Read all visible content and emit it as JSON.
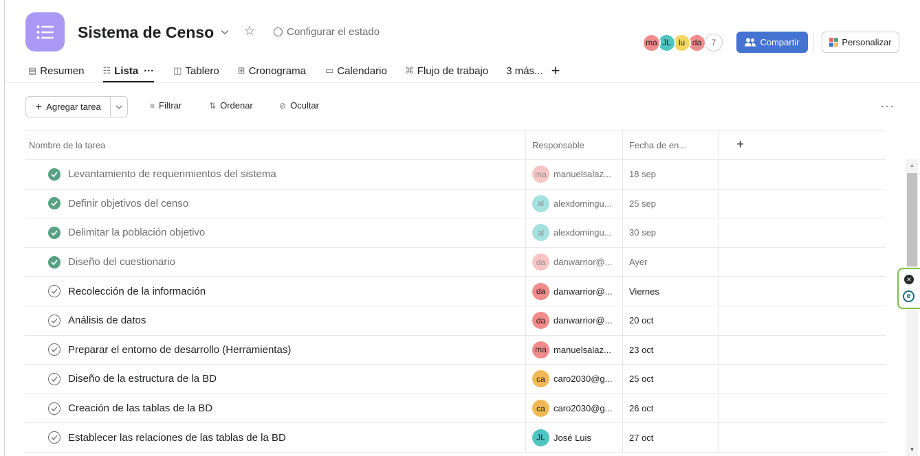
{
  "project": {
    "title": "Sistema de Censo",
    "status_label": "Configurar el estado",
    "icon": "list-icon",
    "accent": "#a999f4"
  },
  "header": {
    "members": [
      {
        "initials": "ma",
        "color": "#f28b8b"
      },
      {
        "initials": "JL",
        "color": "#4ec5c1"
      },
      {
        "initials": "lu",
        "color": "#f2d660"
      },
      {
        "initials": "da",
        "color": "#f28b8b"
      }
    ],
    "member_count": "7",
    "share_label": "Compartir",
    "customize_label": "Personalizar"
  },
  "tabs": [
    {
      "label": "Resumen",
      "icon": "overview-icon"
    },
    {
      "label": "Lista",
      "icon": "list-icon",
      "active": true
    },
    {
      "label": "Tablero",
      "icon": "board-icon"
    },
    {
      "label": "Cronograma",
      "icon": "timeline-icon"
    },
    {
      "label": "Calendario",
      "icon": "calendar-icon"
    },
    {
      "label": "Flujo de trabajo",
      "icon": "workflow-icon"
    },
    {
      "label": "3 más..."
    }
  ],
  "toolbar": {
    "add_task_label": "Agregar tarea",
    "filter_label": "Filtrar",
    "sort_label": "Ordenar",
    "hide_label": "Ocultar"
  },
  "table": {
    "columns": {
      "name": "Nombre de la tarea",
      "assignee": "Responsable",
      "due": "Fecha de en..."
    },
    "rows": [
      {
        "name": "Levantamiento de requerimientos del sistema",
        "done": true,
        "initials": "ma",
        "assignee": "manuelsalaz...",
        "avatar_color": "#f28b8b",
        "due": "18 sep"
      },
      {
        "name": "Definir objetivos del censo",
        "done": true,
        "initials": "al",
        "assignee": "alexdomingu...",
        "avatar_color": "#4ec5c1",
        "due": "25 sep"
      },
      {
        "name": "Delimitar la población objetivo",
        "done": true,
        "initials": "al",
        "assignee": "alexdomingu...",
        "avatar_color": "#4ec5c1",
        "due": "30 sep"
      },
      {
        "name": "Diseño del cuestionario",
        "done": true,
        "initials": "da",
        "assignee": "danwarrior@...",
        "avatar_color": "#f28b8b",
        "due": "Ayer"
      },
      {
        "name": "Recolección de la información",
        "done": false,
        "initials": "da",
        "assignee": "danwarrior@...",
        "avatar_color": "#f28b8b",
        "due": "Viernes"
      },
      {
        "name": "Análisis de datos",
        "done": false,
        "initials": "da",
        "assignee": "danwarrior@...",
        "avatar_color": "#f28b8b",
        "due": "20 oct"
      },
      {
        "name": "Preparar el entorno de desarrollo (Herramientas)",
        "done": false,
        "initials": "ma",
        "assignee": "manuelsalaz...",
        "avatar_color": "#f28b8b",
        "due": "23 oct"
      },
      {
        "name": "Diseño de la estructura de la BD",
        "done": false,
        "initials": "ca",
        "assignee": "caro2030@g...",
        "avatar_color": "#f0b955",
        "due": "25 oct"
      },
      {
        "name": "Creación de las tablas de la BD",
        "done": false,
        "initials": "ca",
        "assignee": "caro2030@g...",
        "avatar_color": "#f0b955",
        "due": "26 oct"
      },
      {
        "name": "Establecer las relaciones de las tablas de la BD",
        "done": false,
        "initials": "JL",
        "assignee": "José Luis",
        "avatar_color": "#4ec5c1",
        "due": "27 oct"
      }
    ]
  },
  "colors": {
    "share_button": "#4573d2",
    "done_check": "#58a182",
    "extension_border": "#7dc242"
  }
}
